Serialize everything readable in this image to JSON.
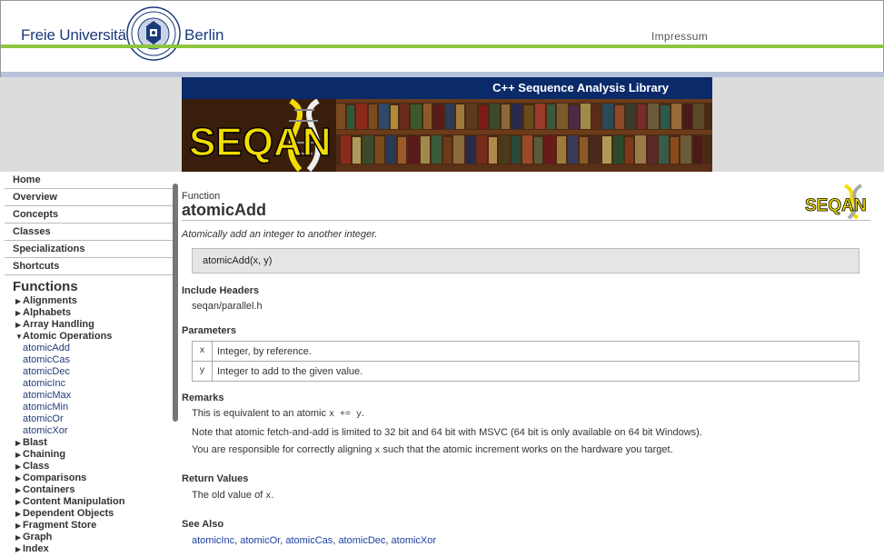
{
  "header": {
    "uni_left": "Freie Universität",
    "uni_right": "Berlin",
    "impressum": "Impressum",
    "colors": {
      "green_line": "#8dc63f",
      "blue_line": "#b5c2da",
      "fu_blue": "#1a3a7a"
    }
  },
  "banner": {
    "title": "C++ Sequence Analysis Library",
    "logo_text": "SEQAN",
    "colors": {
      "bar": "#0a2a6a",
      "logo_yellow": "#f3dc00"
    }
  },
  "sidebar": {
    "top_items": [
      {
        "label": "Home"
      },
      {
        "label": "Overview"
      },
      {
        "label": "Concepts"
      },
      {
        "label": "Classes"
      },
      {
        "label": "Specializations"
      },
      {
        "label": "Shortcuts"
      }
    ],
    "functions_heading": "Functions",
    "categories_before": [
      {
        "label": "Alignments",
        "expanded": false
      },
      {
        "label": "Alphabets",
        "expanded": false
      },
      {
        "label": "Array Handling",
        "expanded": false
      }
    ],
    "expanded_category": {
      "label": "Atomic Operations",
      "expanded": true
    },
    "sub_items": [
      {
        "label": "atomicAdd"
      },
      {
        "label": "atomicCas"
      },
      {
        "label": "atomicDec"
      },
      {
        "label": "atomicInc"
      },
      {
        "label": "atomicMax"
      },
      {
        "label": "atomicMin"
      },
      {
        "label": "atomicOr"
      },
      {
        "label": "atomicXor"
      }
    ],
    "categories_after": [
      {
        "label": "Blast"
      },
      {
        "label": "Chaining"
      },
      {
        "label": "Class"
      },
      {
        "label": "Comparisons"
      },
      {
        "label": "Containers"
      },
      {
        "label": "Content Manipulation"
      },
      {
        "label": "Dependent Objects"
      },
      {
        "label": "Fragment Store"
      },
      {
        "label": "Graph"
      },
      {
        "label": "Index"
      }
    ]
  },
  "content": {
    "kind": "Function",
    "title": "atomicAdd",
    "summary": "Atomically add an integer to another integer.",
    "signature": "atomicAdd(x, y)",
    "include_heading": "Include Headers",
    "include_file": "seqan/parallel.h",
    "params_heading": "Parameters",
    "params": [
      {
        "name": "x",
        "desc": "Integer, by reference."
      },
      {
        "name": "y",
        "desc": "Integer to add to the given value."
      }
    ],
    "remarks_heading": "Remarks",
    "remark1_pre": "This is equivalent to an atomic",
    "remark1_code": "x += y",
    "remark1_post": ".",
    "remark2": "Note that atomic fetch-and-add is limited to 32 bit and 64 bit with MSVC (64 bit is only available on 64 bit Windows).",
    "remark3_pre": "You are responsible for correctly aligning",
    "remark3_code": "x",
    "remark3_post": "such that the atomic increment works on the hardware you target.",
    "return_heading": "Return Values",
    "return_pre": "The old value of",
    "return_code": "x",
    "return_post": ".",
    "see_heading": "See Also",
    "see_also": [
      "atomicInc",
      "atomicOr",
      "atomicCas",
      "atomicDec",
      "atomicXor"
    ]
  }
}
